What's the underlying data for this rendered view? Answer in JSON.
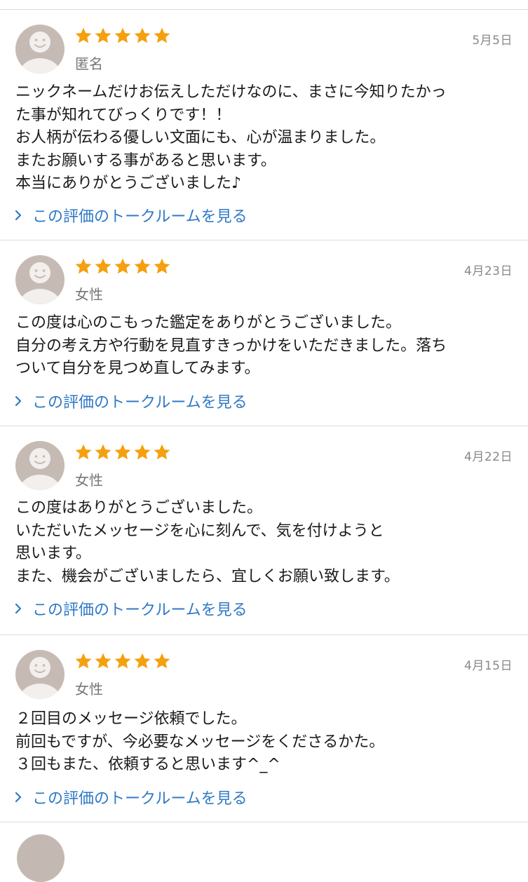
{
  "colors": {
    "star": "#f5a00f",
    "link": "#2f79c4",
    "avatar_bg": "#c6bbb4",
    "divider": "#dddddd"
  },
  "icons": {
    "star": "star-icon",
    "avatar": "default-user-avatar-icon",
    "chevron": "chevron-right-icon"
  },
  "reviews": [
    {
      "rating": 5,
      "reviewer": "匿名",
      "date": "5月5日",
      "lines": [
        "ニックネームだけお伝えしただけなのに、まさに今知りたかっ",
        "た事が知れてびっくりです！！",
        "お人柄が伝わる優しい文面にも、心が温まりました。",
        "またお願いする事があると思います。",
        "本当にありがとうございました♪"
      ],
      "link_label": "この評価のトークルームを見る"
    },
    {
      "rating": 5,
      "reviewer": "女性",
      "date": "4月23日",
      "lines": [
        "この度は心のこもった鑑定をありがとうございました。",
        "自分の考え方や行動を見直すきっかけをいただきました。落ち",
        "ついて自分を見つめ直してみます。"
      ],
      "link_label": "この評価のトークルームを見る"
    },
    {
      "rating": 5,
      "reviewer": "女性",
      "date": "4月22日",
      "lines": [
        "この度はありがとうございました。",
        "いただいたメッセージを心に刻んで、気を付けようと",
        "思います。",
        "また、機会がございましたら、宜しくお願い致します。"
      ],
      "link_label": "この評価のトークルームを見る"
    },
    {
      "rating": 5,
      "reviewer": "女性",
      "date": "4月15日",
      "lines": [
        "２回目のメッセージ依頼でした。",
        "前回もですが、今必要なメッセージをくださるかた。",
        "３回もまた、依頼すると思います^_^"
      ],
      "link_label": "この評価のトークルームを見る"
    }
  ]
}
